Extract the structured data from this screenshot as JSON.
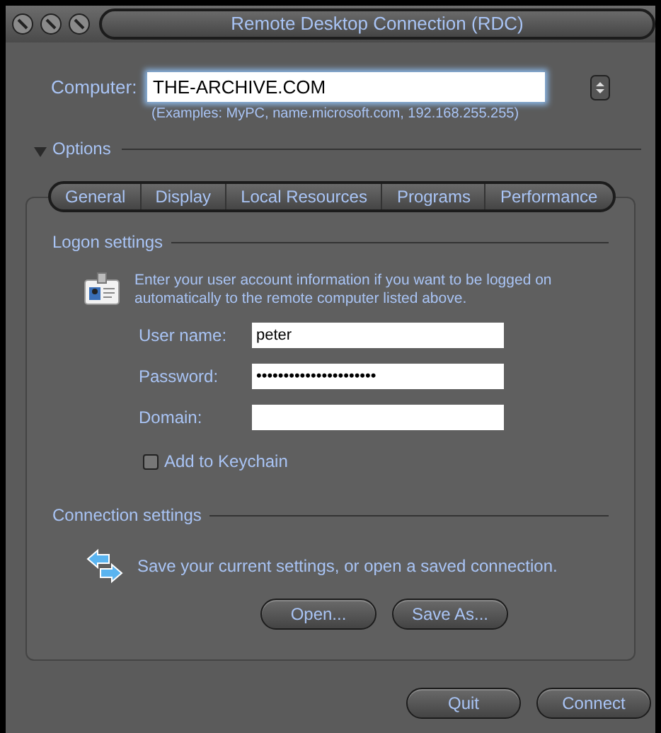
{
  "window": {
    "title": "Remote Desktop Connection (RDC)"
  },
  "computer": {
    "label": "Computer:",
    "value": "THE-ARCHIVE.COM",
    "hint": "(Examples: MyPC, name.microsoft.com, 192.168.255.255)"
  },
  "options": {
    "label": "Options",
    "expanded": true
  },
  "tabs": [
    {
      "label": "General"
    },
    {
      "label": "Display"
    },
    {
      "label": "Local Resources"
    },
    {
      "label": "Programs"
    },
    {
      "label": "Performance"
    }
  ],
  "logon": {
    "heading": "Logon settings",
    "description": "Enter your user account information if you want to be logged on automatically to the remote computer listed above.",
    "fields": [
      {
        "label": "User name:",
        "value": "peter"
      },
      {
        "label": "Password:",
        "value": "••••••••••••••••••••••"
      },
      {
        "label": "Domain:"
      }
    ],
    "keychain": {
      "label": "Add to Keychain",
      "checked": false
    }
  },
  "connection": {
    "heading": "Connection settings",
    "description": "Save your current settings, or open a saved connection.",
    "buttons": [
      "Open...",
      "Save As..."
    ]
  },
  "buttons": [
    "Quit",
    "Connect"
  ]
}
